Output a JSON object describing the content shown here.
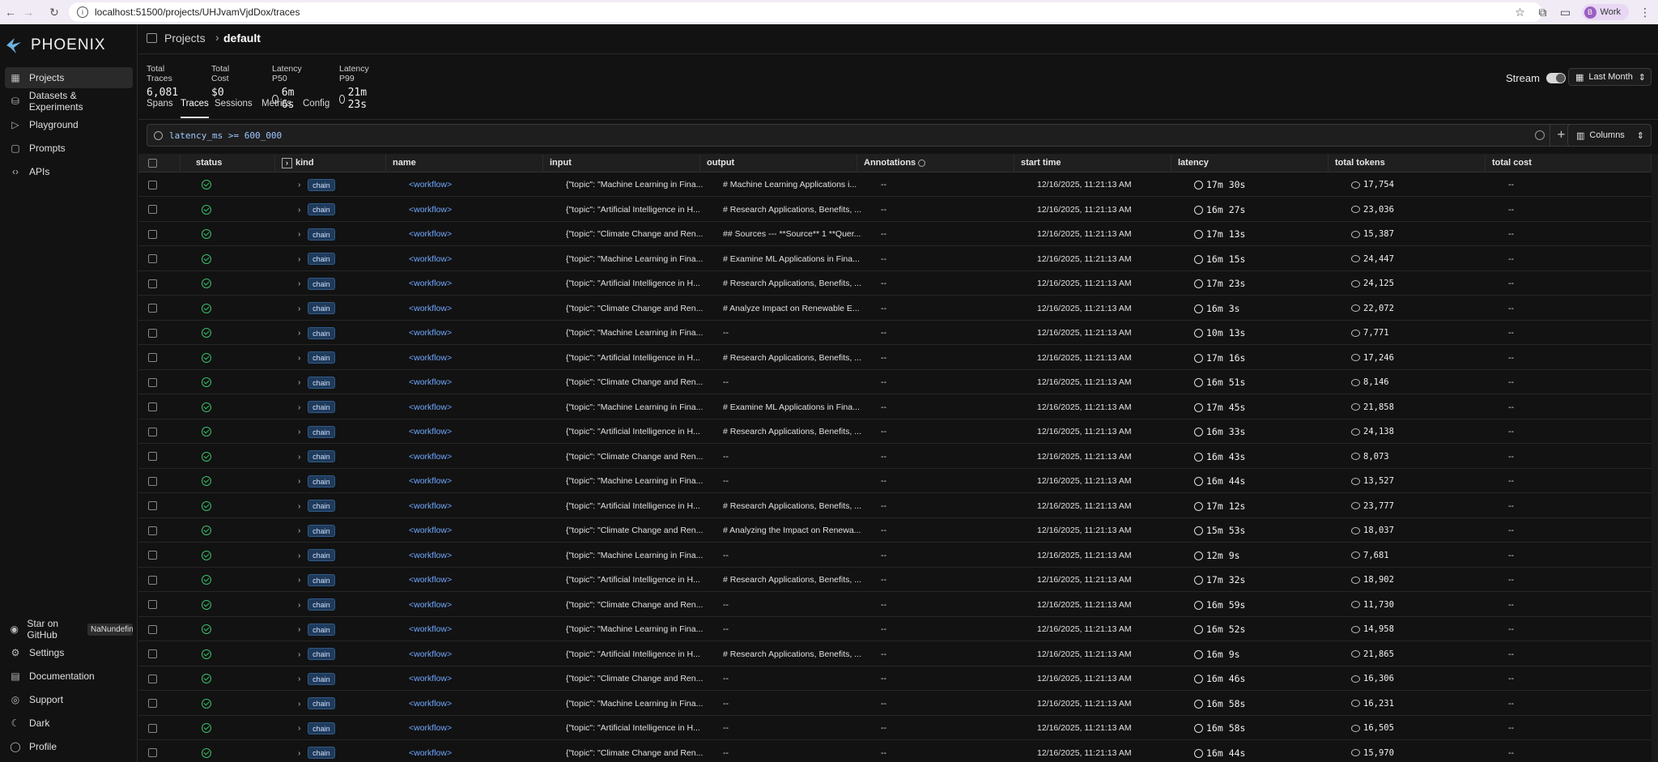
{
  "browser": {
    "url": "localhost:51500/projects/UHJvamVjdDox/traces",
    "profile_initial": "B",
    "profile_name": "Work"
  },
  "sidebar": {
    "logo": "PHOENIX",
    "items": [
      {
        "label": "Projects",
        "icon": "grid-icon"
      },
      {
        "label": "Datasets & Experiments",
        "icon": "database-icon"
      },
      {
        "label": "Playground",
        "icon": "play-icon"
      },
      {
        "label": "Prompts",
        "icon": "message-icon"
      },
      {
        "label": "APIs",
        "icon": "code-icon"
      }
    ],
    "bottom": [
      {
        "label": "Star on GitHub",
        "icon": "github-icon",
        "badge": "NaNundefined"
      },
      {
        "label": "Settings",
        "icon": "gear-icon"
      },
      {
        "label": "Documentation",
        "icon": "book-icon"
      },
      {
        "label": "Support",
        "icon": "support-icon"
      },
      {
        "label": "Dark",
        "icon": "moon-icon"
      },
      {
        "label": "Profile",
        "icon": "user-icon"
      }
    ]
  },
  "breadcrumb": {
    "parent": "Projects",
    "current": "default"
  },
  "stats": [
    {
      "label": "Total Traces",
      "value": "6,081"
    },
    {
      "label": "Total Cost",
      "value": "$0"
    },
    {
      "label": "Latency P50",
      "value": "6m 6s"
    },
    {
      "label": "Latency P99",
      "value": "21m 23s"
    }
  ],
  "stream_label": "Stream",
  "time_range": "Last Month",
  "tabs": [
    "Spans",
    "Traces",
    "Sessions",
    "Metrics",
    "Config"
  ],
  "active_tab": "Traces",
  "filter": {
    "query": "latency_ms >= 600_000"
  },
  "columns_button": "Columns",
  "table": {
    "headers": {
      "status": "status",
      "kind": "kind",
      "name": "name",
      "input": "input",
      "output": "output",
      "annotations": "Annotations",
      "start_time": "start time",
      "latency": "latency",
      "total_tokens": "total tokens",
      "total_cost": "total cost"
    },
    "rows": [
      {
        "kind": "chain",
        "name": "<workflow>",
        "input": "{\"topic\": \"Machine Learning in Fina...",
        "output": "# Machine Learning Applications i...",
        "annotations": "--",
        "start": "12/16/2025, 11:21:13 AM",
        "latency": "17m 30s",
        "tokens": "17,754",
        "cost": "--"
      },
      {
        "kind": "chain",
        "name": "<workflow>",
        "input": "{\"topic\": \"Artificial Intelligence in H...",
        "output": "# Research Applications, Benefits, ...",
        "annotations": "--",
        "start": "12/16/2025, 11:21:13 AM",
        "latency": "16m 27s",
        "tokens": "23,036",
        "cost": "--"
      },
      {
        "kind": "chain",
        "name": "<workflow>",
        "input": "{\"topic\": \"Climate Change and Ren...",
        "output": "## Sources --- **Source** 1 **Quer...",
        "annotations": "--",
        "start": "12/16/2025, 11:21:13 AM",
        "latency": "17m 13s",
        "tokens": "15,387",
        "cost": "--"
      },
      {
        "kind": "chain",
        "name": "<workflow>",
        "input": "{\"topic\": \"Machine Learning in Fina...",
        "output": "# Examine ML Applications in Fina...",
        "annotations": "--",
        "start": "12/16/2025, 11:21:13 AM",
        "latency": "16m 15s",
        "tokens": "24,447",
        "cost": "--"
      },
      {
        "kind": "chain",
        "name": "<workflow>",
        "input": "{\"topic\": \"Artificial Intelligence in H...",
        "output": "# Research Applications, Benefits, ...",
        "annotations": "--",
        "start": "12/16/2025, 11:21:13 AM",
        "latency": "17m 23s",
        "tokens": "24,125",
        "cost": "--"
      },
      {
        "kind": "chain",
        "name": "<workflow>",
        "input": "{\"topic\": \"Climate Change and Ren...",
        "output": "# Analyze Impact on Renewable E...",
        "annotations": "--",
        "start": "12/16/2025, 11:21:13 AM",
        "latency": "16m 3s",
        "tokens": "22,072",
        "cost": "--"
      },
      {
        "kind": "chain",
        "name": "<workflow>",
        "input": "{\"topic\": \"Machine Learning in Fina...",
        "output": "--",
        "annotations": "--",
        "start": "12/16/2025, 11:21:13 AM",
        "latency": "10m 13s",
        "tokens": "7,771",
        "cost": "--"
      },
      {
        "kind": "chain",
        "name": "<workflow>",
        "input": "{\"topic\": \"Artificial Intelligence in H...",
        "output": "# Research Applications, Benefits, ...",
        "annotations": "--",
        "start": "12/16/2025, 11:21:13 AM",
        "latency": "17m 16s",
        "tokens": "17,246",
        "cost": "--"
      },
      {
        "kind": "chain",
        "name": "<workflow>",
        "input": "{\"topic\": \"Climate Change and Ren...",
        "output": "--",
        "annotations": "--",
        "start": "12/16/2025, 11:21:13 AM",
        "latency": "16m 51s",
        "tokens": "8,146",
        "cost": "--"
      },
      {
        "kind": "chain",
        "name": "<workflow>",
        "input": "{\"topic\": \"Machine Learning in Fina...",
        "output": "# Examine ML Applications in Fina...",
        "annotations": "--",
        "start": "12/16/2025, 11:21:13 AM",
        "latency": "17m 45s",
        "tokens": "21,858",
        "cost": "--"
      },
      {
        "kind": "chain",
        "name": "<workflow>",
        "input": "{\"topic\": \"Artificial Intelligence in H...",
        "output": "# Research Applications, Benefits, ...",
        "annotations": "--",
        "start": "12/16/2025, 11:21:13 AM",
        "latency": "16m 33s",
        "tokens": "24,138",
        "cost": "--"
      },
      {
        "kind": "chain",
        "name": "<workflow>",
        "input": "{\"topic\": \"Climate Change and Ren...",
        "output": "--",
        "annotations": "--",
        "start": "12/16/2025, 11:21:13 AM",
        "latency": "16m 43s",
        "tokens": "8,073",
        "cost": "--"
      },
      {
        "kind": "chain",
        "name": "<workflow>",
        "input": "{\"topic\": \"Machine Learning in Fina...",
        "output": "--",
        "annotations": "--",
        "start": "12/16/2025, 11:21:13 AM",
        "latency": "16m 44s",
        "tokens": "13,527",
        "cost": "--"
      },
      {
        "kind": "chain",
        "name": "<workflow>",
        "input": "{\"topic\": \"Artificial Intelligence in H...",
        "output": "# Research Applications, Benefits, ...",
        "annotations": "--",
        "start": "12/16/2025, 11:21:13 AM",
        "latency": "17m 12s",
        "tokens": "23,777",
        "cost": "--"
      },
      {
        "kind": "chain",
        "name": "<workflow>",
        "input": "{\"topic\": \"Climate Change and Ren...",
        "output": "# Analyzing the Impact on Renewa...",
        "annotations": "--",
        "start": "12/16/2025, 11:21:13 AM",
        "latency": "15m 53s",
        "tokens": "18,037",
        "cost": "--"
      },
      {
        "kind": "chain",
        "name": "<workflow>",
        "input": "{\"topic\": \"Machine Learning in Fina...",
        "output": "--",
        "annotations": "--",
        "start": "12/16/2025, 11:21:13 AM",
        "latency": "12m 9s",
        "tokens": "7,681",
        "cost": "--"
      },
      {
        "kind": "chain",
        "name": "<workflow>",
        "input": "{\"topic\": \"Artificial Intelligence in H...",
        "output": "# Research Applications, Benefits, ...",
        "annotations": "--",
        "start": "12/16/2025, 11:21:13 AM",
        "latency": "17m 32s",
        "tokens": "18,902",
        "cost": "--"
      },
      {
        "kind": "chain",
        "name": "<workflow>",
        "input": "{\"topic\": \"Climate Change and Ren...",
        "output": "--",
        "annotations": "--",
        "start": "12/16/2025, 11:21:13 AM",
        "latency": "16m 59s",
        "tokens": "11,730",
        "cost": "--"
      },
      {
        "kind": "chain",
        "name": "<workflow>",
        "input": "{\"topic\": \"Machine Learning in Fina...",
        "output": "--",
        "annotations": "--",
        "start": "12/16/2025, 11:21:13 AM",
        "latency": "16m 52s",
        "tokens": "14,958",
        "cost": "--"
      },
      {
        "kind": "chain",
        "name": "<workflow>",
        "input": "{\"topic\": \"Artificial Intelligence in H...",
        "output": "# Research Applications, Benefits, ...",
        "annotations": "--",
        "start": "12/16/2025, 11:21:13 AM",
        "latency": "16m 9s",
        "tokens": "21,865",
        "cost": "--"
      },
      {
        "kind": "chain",
        "name": "<workflow>",
        "input": "{\"topic\": \"Climate Change and Ren...",
        "output": "--",
        "annotations": "--",
        "start": "12/16/2025, 11:21:13 AM",
        "latency": "16m 46s",
        "tokens": "16,306",
        "cost": "--"
      },
      {
        "kind": "chain",
        "name": "<workflow>",
        "input": "{\"topic\": \"Machine Learning in Fina...",
        "output": "--",
        "annotations": "--",
        "start": "12/16/2025, 11:21:13 AM",
        "latency": "16m 58s",
        "tokens": "16,231",
        "cost": "--"
      },
      {
        "kind": "chain",
        "name": "<workflow>",
        "input": "{\"topic\": \"Artificial Intelligence in H...",
        "output": "--",
        "annotations": "--",
        "start": "12/16/2025, 11:21:13 AM",
        "latency": "16m 58s",
        "tokens": "16,505",
        "cost": "--"
      },
      {
        "kind": "chain",
        "name": "<workflow>",
        "input": "{\"topic\": \"Climate Change and Ren...",
        "output": "--",
        "annotations": "--",
        "start": "12/16/2025, 11:21:13 AM",
        "latency": "16m 44s",
        "tokens": "15,970",
        "cost": "--"
      }
    ]
  }
}
